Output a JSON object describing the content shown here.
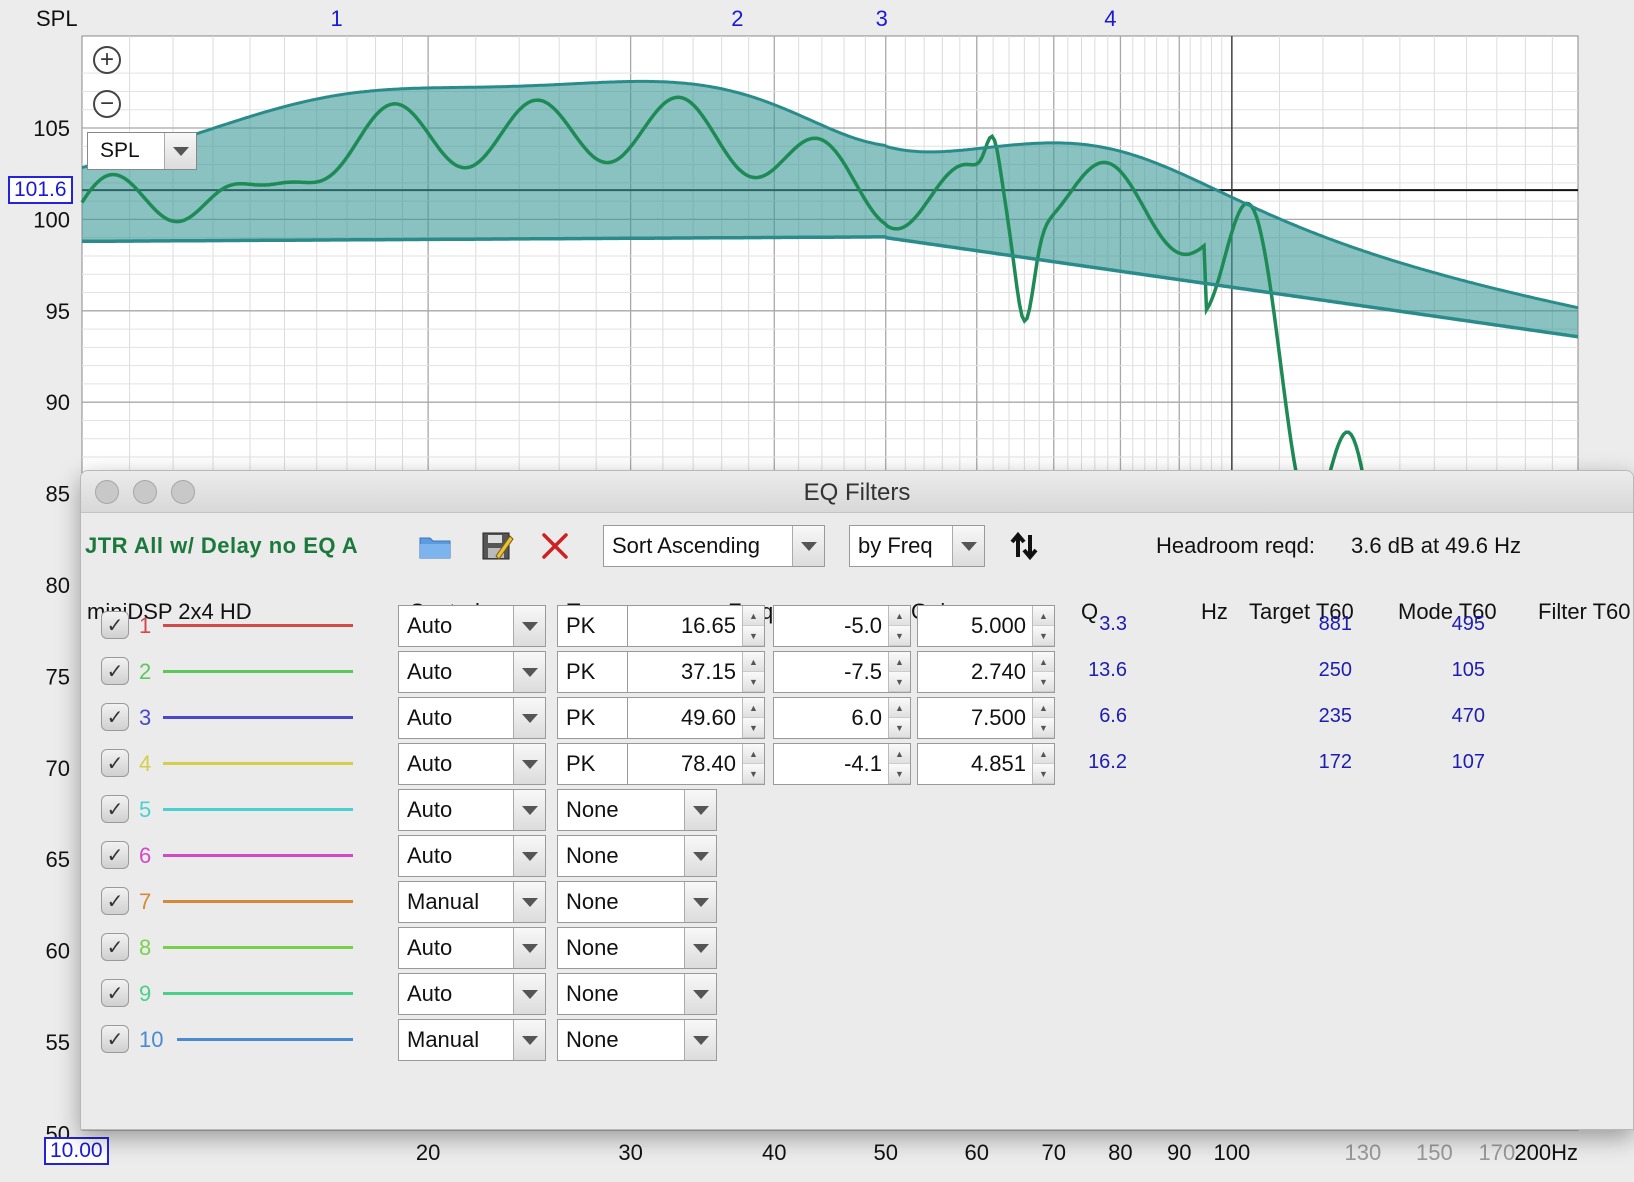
{
  "graph": {
    "y_axis_title": "SPL",
    "y_ticks": [
      "105",
      "100",
      "95",
      "90",
      "85",
      "80",
      "75",
      "70",
      "65",
      "60",
      "55",
      "50"
    ],
    "x_ticks": [
      "20",
      "30",
      "40",
      "50",
      "60",
      "70",
      "80",
      "90",
      "100"
    ],
    "x_ticks_faded": [
      "130",
      "150",
      "170"
    ],
    "x_end_label": "200Hz",
    "x_start_badge": "10.00",
    "y_cursor_badge": "101.6",
    "filter_markers": [
      "1",
      "2",
      "3",
      "4"
    ],
    "spl_selector": "SPL",
    "curve_color": "#1e8a55",
    "fill_color": "#3a9a96"
  },
  "dialog": {
    "title": "EQ Filters",
    "config_name": "JTR All w/ Delay no EQ A",
    "icons": [
      "folder-open-icon",
      "save-icon",
      "delete-icon",
      "sort-direction-icon"
    ],
    "sort_order": "Sort Ascending",
    "sort_by": "by Freq",
    "headroom_label": "Headroom reqd:",
    "headroom_value": "3.6 dB at 49.6 Hz",
    "columns": {
      "device": "miniDSP 2x4 HD",
      "control": "Control",
      "type": "Type",
      "frequency": "Frequency",
      "gain": "Gain",
      "q": "Q",
      "hz": "Hz",
      "target_t60": "Target T60",
      "mode_t60": "Mode T60",
      "filter_t60": "Filter T60"
    },
    "filters": [
      {
        "num": "1",
        "color": "#d24a4a",
        "control": "Auto",
        "type": "PK",
        "frequency": "16.65",
        "gain": "-5.0",
        "q": "5.000",
        "hz": "3.3",
        "mode_t60": "881",
        "filter_t60": "495"
      },
      {
        "num": "2",
        "color": "#5cc85c",
        "control": "Auto",
        "type": "PK",
        "frequency": "37.15",
        "gain": "-7.5",
        "q": "2.740",
        "hz": "13.6",
        "mode_t60": "250",
        "filter_t60": "105"
      },
      {
        "num": "3",
        "color": "#4a4ac8",
        "control": "Auto",
        "type": "PK",
        "frequency": "49.60",
        "gain": "6.0",
        "q": "7.500",
        "hz": "6.6",
        "mode_t60": "235",
        "filter_t60": "470"
      },
      {
        "num": "4",
        "color": "#d4cf4a",
        "control": "Auto",
        "type": "PK",
        "frequency": "78.40",
        "gain": "-4.1",
        "q": "4.851",
        "hz": "16.2",
        "mode_t60": "172",
        "filter_t60": "107"
      },
      {
        "num": "5",
        "color": "#4ad0d0",
        "control": "Auto",
        "type": "None"
      },
      {
        "num": "6",
        "color": "#d04ac8",
        "control": "Auto",
        "type": "None"
      },
      {
        "num": "7",
        "color": "#d48a3a",
        "control": "Manual",
        "type": "None"
      },
      {
        "num": "8",
        "color": "#7ad04a",
        "control": "Auto",
        "type": "None"
      },
      {
        "num": "9",
        "color": "#4ad08a",
        "control": "Auto",
        "type": "None"
      },
      {
        "num": "10",
        "color": "#4a8ad0",
        "control": "Manual",
        "type": "None"
      }
    ]
  }
}
